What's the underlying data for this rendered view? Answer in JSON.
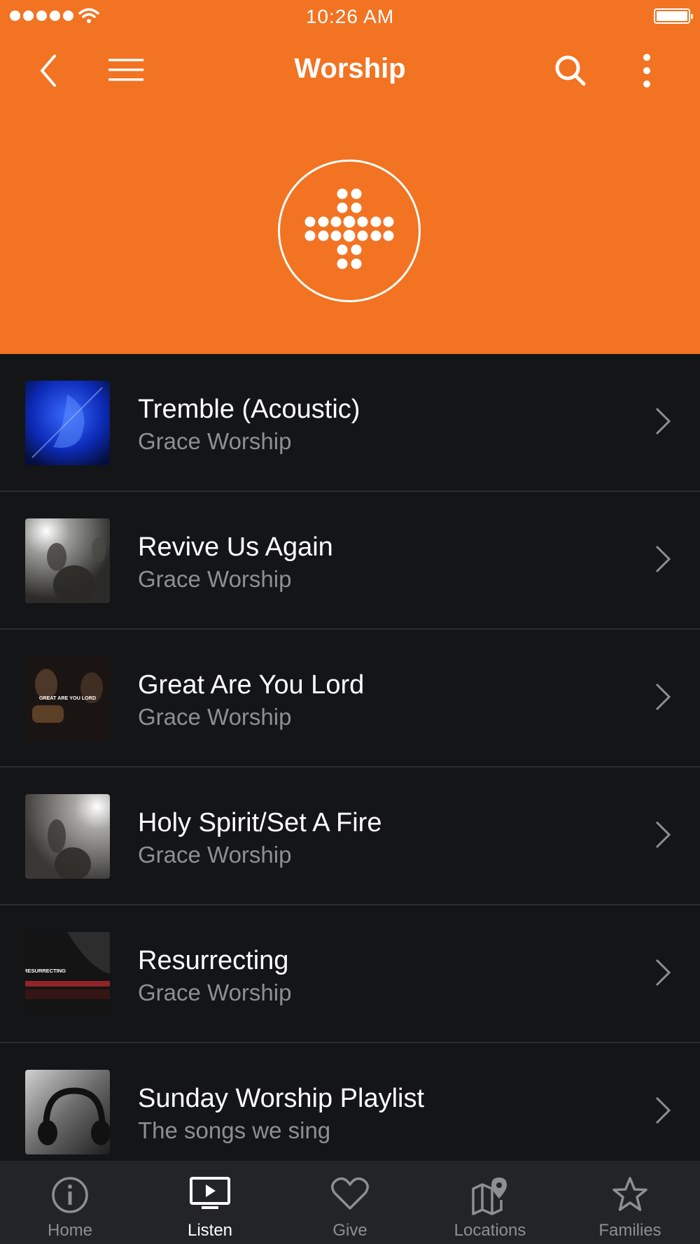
{
  "status_bar": {
    "time": "10:26 AM"
  },
  "header": {
    "title": "Worship"
  },
  "items": [
    {
      "title": "Tremble (Acoustic)",
      "subtitle": "Grace Worship"
    },
    {
      "title": "Revive Us Again",
      "subtitle": "Grace Worship"
    },
    {
      "title": "Great Are You Lord",
      "subtitle": "Grace Worship",
      "thumb_text": "GREAT ARE YOU LORD"
    },
    {
      "title": "Holy Spirit/Set A Fire",
      "subtitle": "Grace Worship"
    },
    {
      "title": "Resurrecting",
      "subtitle": "Grace Worship",
      "thumb_text": "RESURRECTING"
    },
    {
      "title": "Sunday Worship Playlist",
      "subtitle": "The songs we sing"
    }
  ],
  "tabs": [
    {
      "label": "Home",
      "icon": "info-icon"
    },
    {
      "label": "Listen",
      "icon": "tv-play-icon",
      "active": true
    },
    {
      "label": "Give",
      "icon": "heart-icon"
    },
    {
      "label": "Locations",
      "icon": "map-icon"
    },
    {
      "label": "Families",
      "icon": "star-icon"
    }
  ],
  "colors": {
    "accent": "#f27322",
    "background": "#141517",
    "tabbar": "#232427"
  }
}
